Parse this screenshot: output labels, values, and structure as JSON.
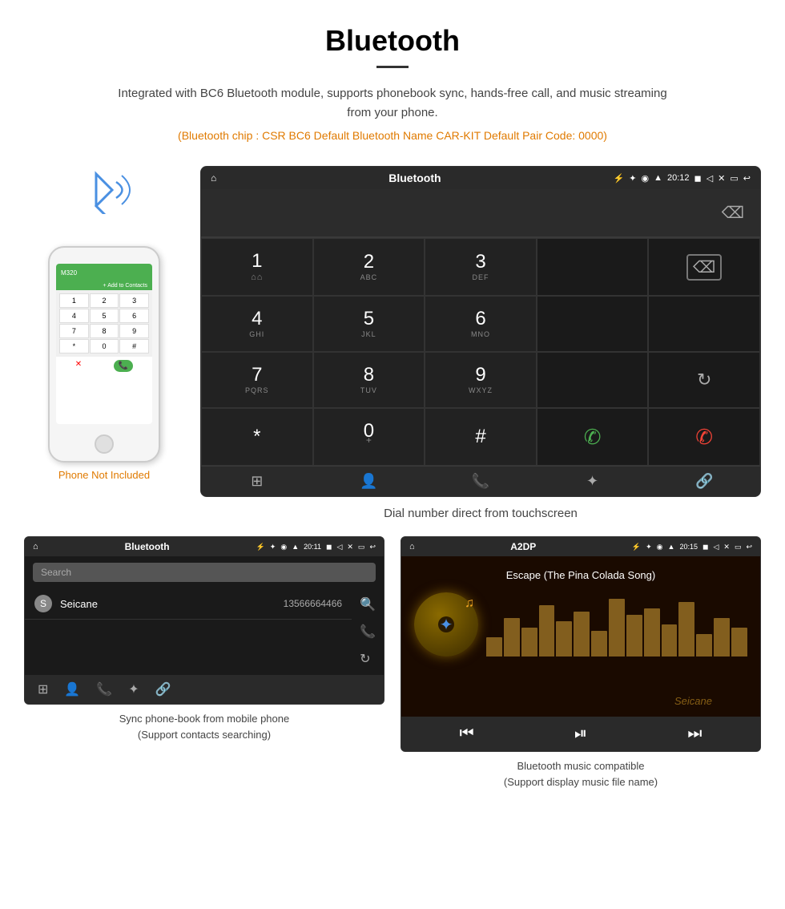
{
  "header": {
    "title": "Bluetooth",
    "description": "Integrated with BC6 Bluetooth module, supports phonebook sync, hands-free call, and music streaming from your phone.",
    "specs": "(Bluetooth chip : CSR BC6    Default Bluetooth Name CAR-KIT    Default Pair Code: 0000)"
  },
  "phone": {
    "not_included_label": "Phone Not Included"
  },
  "dial_screen": {
    "status_bar": {
      "home_icon": "⌂",
      "title": "Bluetooth",
      "usb_icon": "⚡",
      "bt_icon": "✦",
      "location_icon": "◉",
      "signal_icon": "▲",
      "time": "20:12",
      "camera_icon": "◼",
      "volume_icon": "◁",
      "close_icon": "✕",
      "window_icon": "▭",
      "back_icon": "↩"
    },
    "keys": [
      {
        "main": "1",
        "sub": "⌂⌂"
      },
      {
        "main": "2",
        "sub": "ABC"
      },
      {
        "main": "3",
        "sub": "DEF"
      },
      {
        "main": "",
        "sub": ""
      },
      {
        "main": "⌫",
        "sub": ""
      },
      {
        "main": "4",
        "sub": "GHI"
      },
      {
        "main": "5",
        "sub": "JKL"
      },
      {
        "main": "6",
        "sub": "MNO"
      },
      {
        "main": "",
        "sub": ""
      },
      {
        "main": "",
        "sub": ""
      },
      {
        "main": "7",
        "sub": "PQRS"
      },
      {
        "main": "8",
        "sub": "TUV"
      },
      {
        "main": "9",
        "sub": "WXYZ"
      },
      {
        "main": "",
        "sub": ""
      },
      {
        "main": "↻",
        "sub": ""
      },
      {
        "main": "✱",
        "sub": ""
      },
      {
        "main": "0",
        "sub": "+"
      },
      {
        "main": "#",
        "sub": ""
      },
      {
        "main": "✆",
        "sub": ""
      },
      {
        "main": "",
        "sub": ""
      },
      {
        "main": "📱",
        "sub": ""
      },
      {
        "main": "",
        "sub": ""
      },
      {
        "main": "",
        "sub": ""
      },
      {
        "main": "",
        "sub": ""
      },
      {
        "main": "",
        "sub": ""
      }
    ],
    "bottom_nav": [
      "⊞",
      "👤",
      "📞",
      "✦",
      "🔗"
    ]
  },
  "dial_caption": "Dial number direct from touchscreen",
  "phonebook_screen": {
    "status_bar": {
      "title": "Bluetooth",
      "time": "20:11"
    },
    "search_placeholder": "Search",
    "contacts": [
      {
        "letter": "S",
        "name": "Seicane",
        "number": "13566664466"
      }
    ],
    "bottom_nav": [
      "⊞",
      "👤",
      "📞",
      "✦",
      "🔗"
    ]
  },
  "phonebook_caption": {
    "line1": "Sync phone-book from mobile phone",
    "line2": "(Support contacts searching)"
  },
  "music_screen": {
    "status_bar": {
      "title": "A2DP",
      "time": "20:15"
    },
    "song_title": "Escape (The Pina Colada Song)",
    "controls": [
      "⏮",
      "⏯",
      "⏭"
    ]
  },
  "music_caption": {
    "line1": "Bluetooth music compatible",
    "line2": "(Support display music file name)"
  },
  "watermark": "Seicane"
}
